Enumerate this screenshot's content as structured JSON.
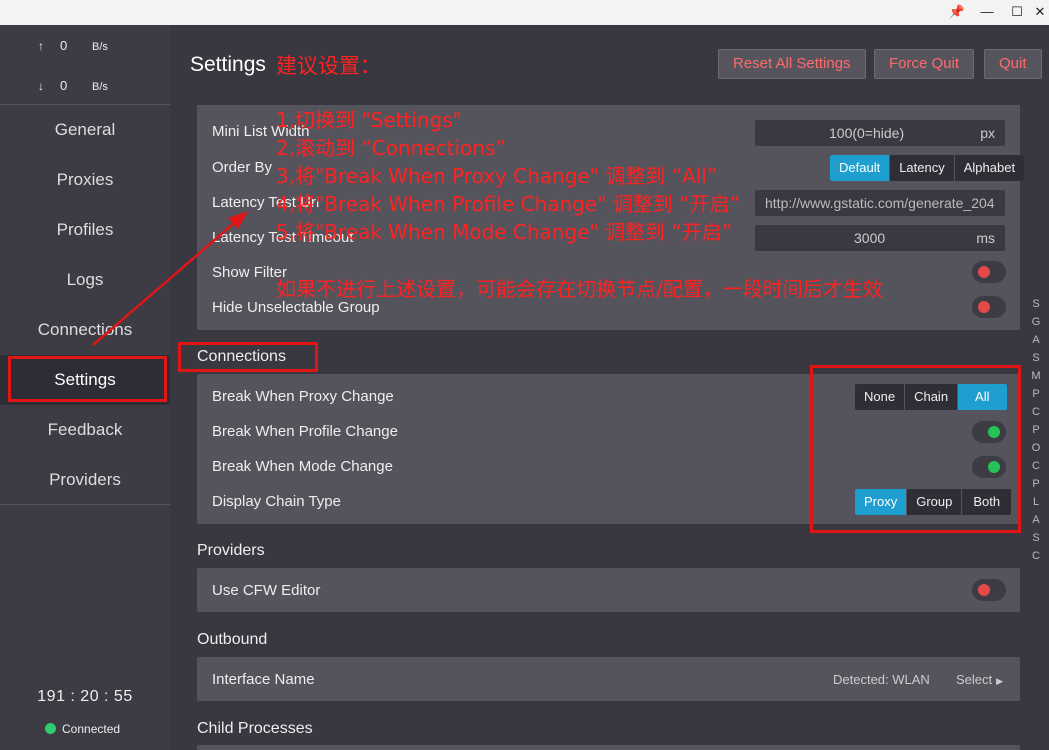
{
  "titlebar": {
    "pin": "📌",
    "minimize": "—",
    "maximize": "☐",
    "close": "✕"
  },
  "traffic": {
    "up_arrow": "↑",
    "up_value": "0",
    "up_unit": "B/s",
    "down_arrow": "↓",
    "down_value": "0",
    "down_unit": "B/s"
  },
  "nav": [
    "General",
    "Proxies",
    "Profiles",
    "Logs",
    "Connections",
    "Settings",
    "Feedback",
    "Providers"
  ],
  "clock": "191 : 20 : 55",
  "status": "Connected",
  "header": {
    "title": "Settings",
    "reset": "Reset All Settings",
    "force_quit": "Force Quit",
    "quit": "Quit"
  },
  "general_card": {
    "mini_list_label": "Mini List Width",
    "mini_list_value": "100(0=hide)",
    "mini_list_unit": "px",
    "order_by_label": "Order By",
    "order_opts": [
      "Default",
      "Latency",
      "Alphabet"
    ],
    "latency_url_label": "Latency Test Url",
    "latency_url_value": "http://www.gstatic.com/generate_204",
    "latency_timeout_label": "Latency Test Timeout",
    "latency_timeout_value": "3000",
    "latency_timeout_unit": "ms",
    "show_filter_label": "Show Filter",
    "hide_unselectable_label": "Hide Unselectable Group"
  },
  "connections": {
    "title": "Connections",
    "break_proxy": "Break When Proxy Change",
    "break_proxy_opts": [
      "None",
      "Chain",
      "All"
    ],
    "break_profile": "Break When Profile Change",
    "break_mode": "Break When Mode Change",
    "display_chain": "Display Chain Type",
    "display_chain_opts": [
      "Proxy",
      "Group",
      "Both"
    ]
  },
  "providers": {
    "title": "Providers",
    "cfw_editor": "Use CFW Editor"
  },
  "outbound": {
    "title": "Outbound",
    "interface": "Interface Name",
    "detected": "Detected: WLAN",
    "select": "Select"
  },
  "child_processes": {
    "title": "Child Processes"
  },
  "index_letters": [
    "S",
    "G",
    "A",
    "S",
    "M",
    "P",
    "C",
    "P",
    "O",
    "C",
    "P",
    "L",
    "A",
    "S",
    "C"
  ],
  "annotations": {
    "title": "建议设置：",
    "step1": "1,切换到 \"Settings\"",
    "step2": "2,滚动到 “Connections”",
    "step3": "3,将\"Break When Proxy Change\" 调整到 “All”",
    "step4": "4,将\"Break When Profile Change\" 调整到 “开启”",
    "step5": "5,将\"Break When Mode Change\" 调整到 “开启”",
    "note": "如果不进行上述设置，可能会存在切换节点/配置，一段时间后才生效"
  },
  "colors": {
    "accent": "#1f9fcf",
    "danger": "#e54848",
    "ok": "#27c255",
    "annotation": "#ff2222"
  }
}
